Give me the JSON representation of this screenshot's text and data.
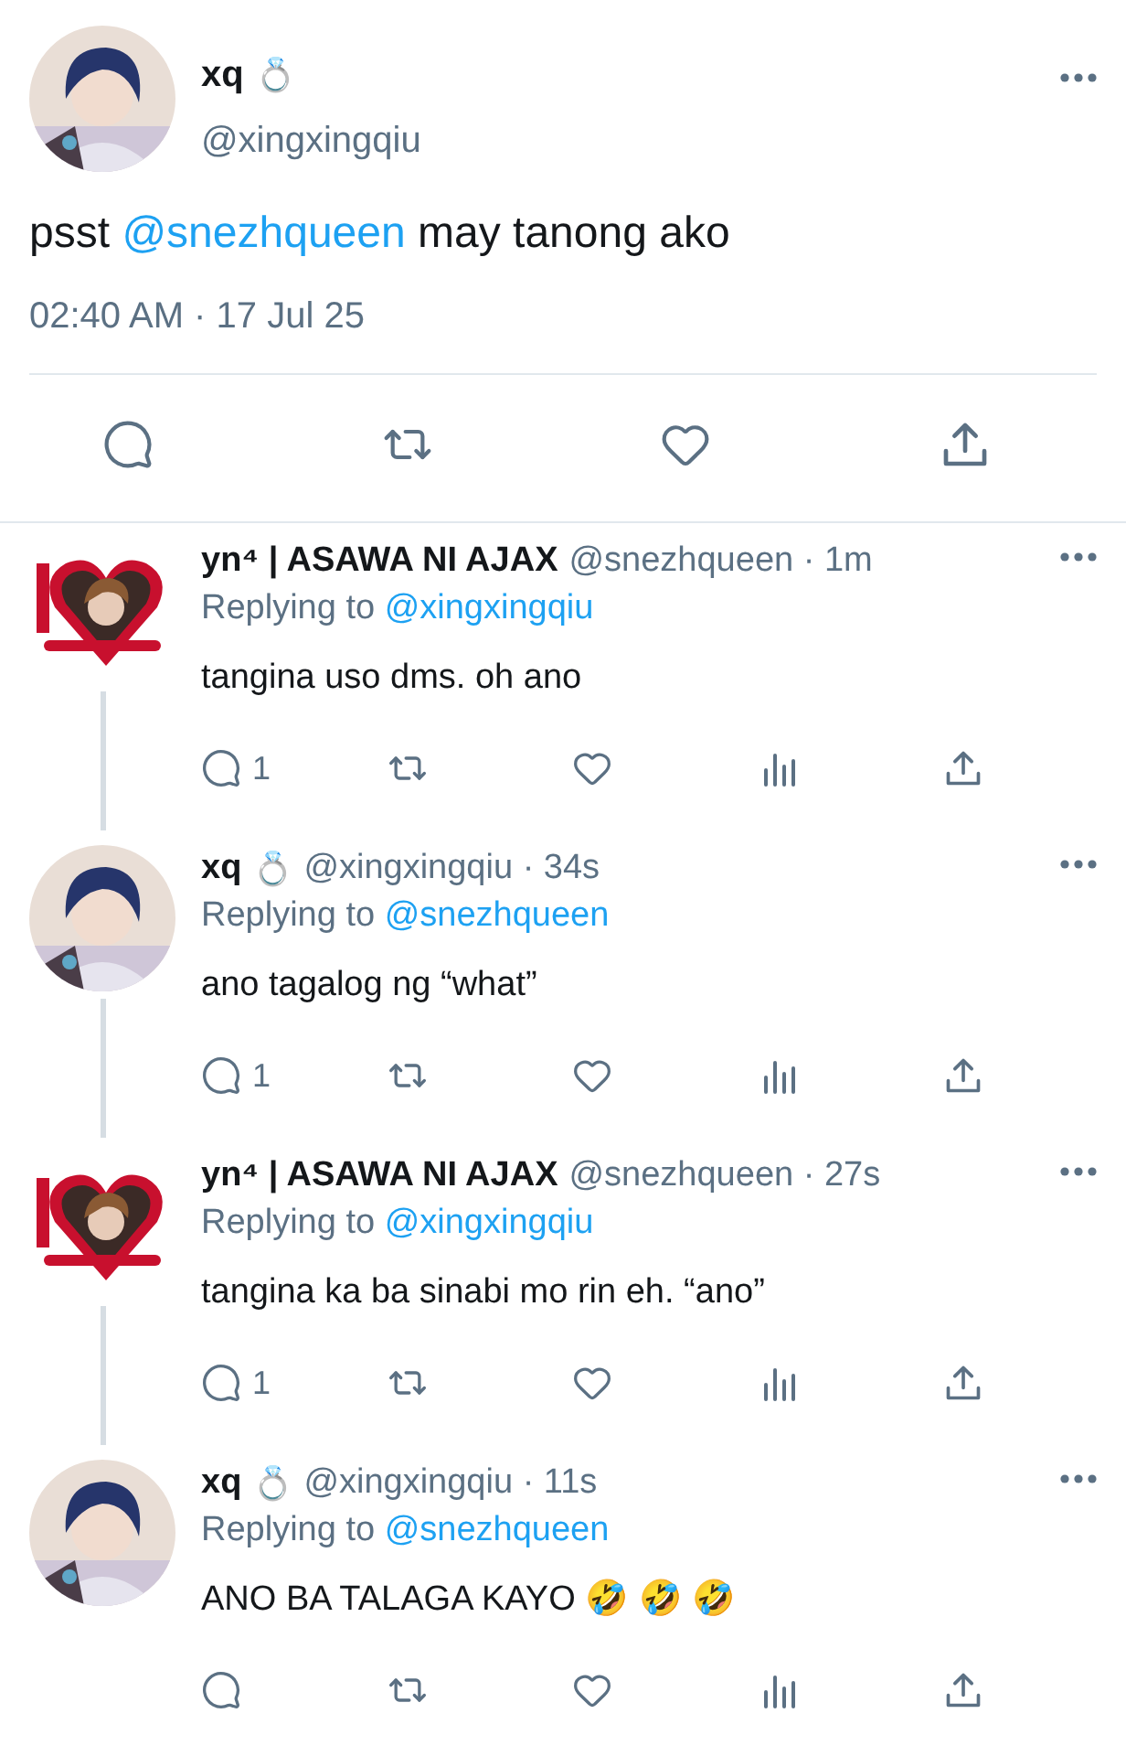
{
  "main_tweet": {
    "name": "xq",
    "badge": "💍",
    "handle": "@xingxingqiu",
    "avatar": {
      "kind": "circle"
    },
    "text": [
      {
        "kind": "plain",
        "t": "psst "
      },
      {
        "kind": "mention",
        "t": "@snezhqueen"
      },
      {
        "kind": "plain",
        "t": " may tanong ako"
      }
    ],
    "timestamp": "02:40 AM · 17 Jul 25",
    "actions": [
      {
        "kind": "reply"
      },
      {
        "kind": "retweet"
      },
      {
        "kind": "like"
      },
      {
        "kind": "share"
      }
    ]
  },
  "replies": [
    {
      "name": "yn⁴ | ASAWA NI AJAX",
      "meta": "@snezhqueen · 1m",
      "avatar": {
        "kind": "heart"
      },
      "replying_label": "Replying to",
      "replying_to": "@xingxingqiu",
      "text": "tangina uso dms. oh ano",
      "reply_count": "1",
      "thread_continues": true
    },
    {
      "name": "xq",
      "badge": "💍",
      "meta": "@xingxingqiu · 34s",
      "avatar": {
        "kind": "circle"
      },
      "replying_label": "Replying to",
      "replying_to": "@snezhqueen",
      "text": "ano tagalog ng “what”",
      "reply_count": "1",
      "thread_continues": true
    },
    {
      "name": "yn⁴ | ASAWA NI AJAX",
      "meta": "@snezhqueen · 27s",
      "avatar": {
        "kind": "heart"
      },
      "replying_label": "Replying to",
      "replying_to": "@xingxingqiu",
      "text": "tangina ka ba sinabi mo rin eh. “ano”",
      "reply_count": "1",
      "thread_continues": true
    },
    {
      "name": "xq",
      "badge": "💍",
      "meta": "@xingxingqiu · 11s",
      "avatar": {
        "kind": "circle"
      },
      "replying_label": "Replying to",
      "replying_to": "@snezhqueen",
      "text": "ANO BA TALAGA KAYO 🤣 🤣 🤣",
      "thread_continues": false
    }
  ]
}
